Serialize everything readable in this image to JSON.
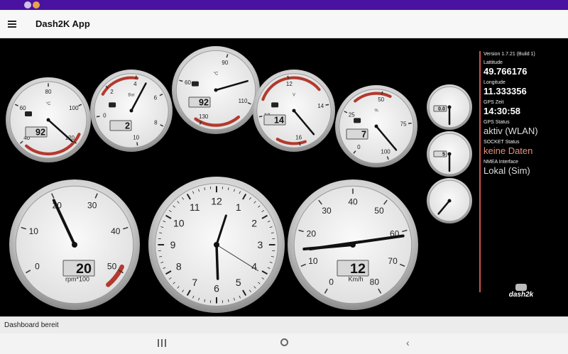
{
  "app": {
    "title": "Dash2K App"
  },
  "colors": {
    "statusbar": "#4a12a0",
    "accent_red": "#c9554a",
    "gauge_face": "#f4f4f4",
    "dashboard_bg": "#000000"
  },
  "icons": {
    "menu": "hamburger-menu-icon",
    "recents": "recents-icon",
    "home": "home-icon",
    "back": "back-icon"
  },
  "gauges": [
    {
      "id": "coolant-temp",
      "icon": "thermometer-icon",
      "unit_label": "°C",
      "ticks": [
        "40",
        "60",
        "80",
        "100",
        "120"
      ],
      "lcd": "92"
    },
    {
      "id": "oil-pressure",
      "icon": "oil-can-icon",
      "unit_label": "Bar",
      "ticks": [
        "0",
        "2",
        "4",
        "6",
        "8",
        "10"
      ],
      "lcd": "2"
    },
    {
      "id": "oil-temp",
      "icon": "thermometer-icon",
      "unit_label": "°C",
      "ticks": [
        "60",
        "90",
        "110",
        "130"
      ],
      "lcd": "92"
    },
    {
      "id": "battery",
      "icon": "battery-icon",
      "unit_label": "V",
      "ticks": [
        "10",
        "12",
        "14",
        "16"
      ],
      "lcd": "14"
    },
    {
      "id": "fuel",
      "icon": "fuel-pump-icon",
      "unit_label": "%",
      "ticks": [
        "0",
        "25",
        "50",
        "75",
        "100"
      ],
      "lcd": "7"
    },
    {
      "id": "rpm",
      "ticks": [
        "0",
        "10",
        "20",
        "30",
        "40",
        "50"
      ],
      "lcd": "20",
      "unit": "rpm*100"
    },
    {
      "id": "clock",
      "ticks": [
        "12",
        "1",
        "2",
        "3",
        "4",
        "5",
        "6",
        "7",
        "8",
        "9",
        "10",
        "11"
      ]
    },
    {
      "id": "speed",
      "ticks": [
        "0",
        "10",
        "20",
        "30",
        "40",
        "50",
        "60",
        "70",
        "80"
      ],
      "lcd": "12",
      "unit": "Km/h"
    },
    {
      "id": "small-1",
      "lcd": "0.0"
    },
    {
      "id": "small-2",
      "lcd": "5"
    },
    {
      "id": "small-3"
    }
  ],
  "info": {
    "version": "Version 1.7.21 (Build 1)",
    "latitude_label": "Lattitude",
    "latitude": "49.766176",
    "longitude_label": "Longitude",
    "longitude": "11.333356",
    "gps_time_label": "GPS Zeit",
    "gps_time": "14:30:58",
    "gps_status_label": "GPS Status",
    "gps_status": "aktiv (WLAN)",
    "socket_status_label": "SOCKET Status",
    "socket_status": "keine Daten",
    "nmea_label": "NMEA Interface",
    "nmea": "Lokal (Sim)"
  },
  "logo_text": "dash2k",
  "status_line": "Dashboard bereit"
}
